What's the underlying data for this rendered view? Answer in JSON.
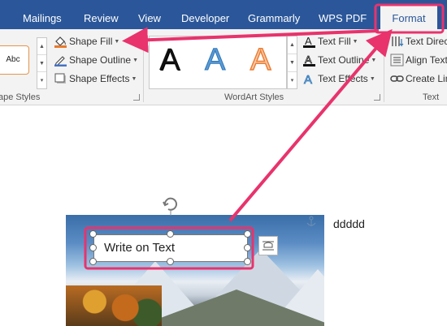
{
  "ribbon_tabs": [
    "Mailings",
    "Review",
    "View",
    "Developer",
    "Grammarly",
    "WPS PDF"
  ],
  "active_tab": "Format",
  "shape_styles": {
    "group_label": "ape Styles",
    "swatch_label": "Abc",
    "commands": [
      {
        "label": "Shape Fill",
        "icon": "paint-bucket-icon"
      },
      {
        "label": "Shape Outline",
        "icon": "pen-outline-icon"
      },
      {
        "label": "Shape Effects",
        "icon": "shape-effects-icon"
      }
    ]
  },
  "wordart_styles": {
    "group_label": "WordArt Styles",
    "letters": [
      {
        "text": "A",
        "color": "#111111"
      },
      {
        "text": "A",
        "color": "#5b9bd5"
      },
      {
        "text": "A",
        "color": "#f4b183"
      }
    ],
    "commands": [
      {
        "label": "Text Fill",
        "icon": "text-fill-icon"
      },
      {
        "label": "Text Outline",
        "icon": "text-outline-icon"
      },
      {
        "label": "Text Effects",
        "icon": "text-effects-icon"
      }
    ]
  },
  "text_group": {
    "group_label": "Text",
    "commands": [
      {
        "label": "Text Direc",
        "icon": "text-direction-icon"
      },
      {
        "label": "Align Text",
        "icon": "align-text-icon"
      },
      {
        "label": "Create Lin",
        "icon": "create-link-icon"
      }
    ]
  },
  "document": {
    "textbox_text": "Write on Text",
    "side_text": "ddddd"
  },
  "colors": {
    "ribbon_blue": "#2b579a",
    "annotation_pink": "#e8336d"
  }
}
